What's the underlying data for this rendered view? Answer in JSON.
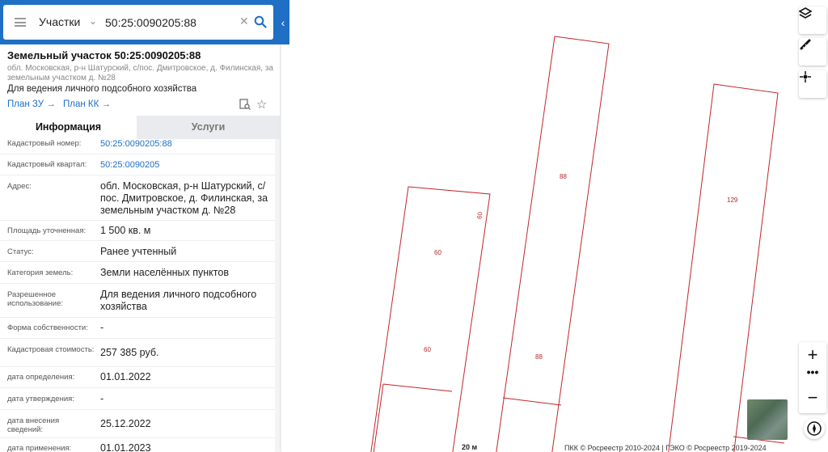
{
  "search": {
    "mode": "Участки",
    "query": "50:25:0090205:88"
  },
  "parcel": {
    "title": "Земельный участок 50:25:0090205:88",
    "address_short": "обл. Московская, р-н Шатурский, с/пос. Дмитровское, д. Филинская, за земельным участком д. №28",
    "usage": "Для ведения личного подсобного хозяйства",
    "link_plan_zu": "План ЗУ",
    "link_plan_kk": "План КК"
  },
  "tabs": {
    "info": "Информация",
    "services": "Услуги"
  },
  "info_rows": [
    {
      "label": "Кадастровый номер:",
      "value": "50:25:0090205:88",
      "link": true
    },
    {
      "label": "Кадастровый квартал:",
      "value": "50:25:0090205",
      "link": true
    },
    {
      "label": "Адрес:",
      "value": "обл. Московская, р-н Шатурский, с/пос. Дмитровское, д. Филинская, за земельным участком д. №28",
      "link": false
    },
    {
      "label": "Площадь уточненная:",
      "value": "1 500 кв. м",
      "link": false
    },
    {
      "label": "Статус:",
      "value": "Ранее учтенный",
      "link": false
    },
    {
      "label": "Категория земель:",
      "value": "Земли населённых пунктов",
      "link": false
    },
    {
      "label": "Разрешенное использование:",
      "value": "Для ведения личного подсобного хозяйства",
      "link": false
    },
    {
      "label": "Форма собственности:",
      "value": "-",
      "link": false
    },
    {
      "label": "Кадастровая стоимость:",
      "value": "257 385 руб.",
      "link": false
    },
    {
      "label": "дата определения:",
      "value": "01.01.2022",
      "link": false
    },
    {
      "label": "дата утверждения:",
      "value": "-",
      "link": false
    },
    {
      "label": "дата внесения сведений:",
      "value": "25.12.2022",
      "link": false
    },
    {
      "label": "дата применения:",
      "value": "01.01.2023",
      "link": false
    }
  ],
  "map": {
    "plot_labels": [
      "60",
      "60",
      "60",
      "88",
      "88",
      "129"
    ],
    "scale": "20 м",
    "copyright": "ПКК © Росреестр 2010-2024 | ГЭКО © Росреестр 2019-2024",
    "zoom_in": "+",
    "zoom_more": "•••",
    "zoom_out": "−"
  },
  "colors": {
    "accent": "#1f6fc5",
    "plot_border": "#c0262b"
  },
  "icons": {
    "layers": "layers-icon",
    "ruler": "ruler-icon",
    "locate": "crosshair-icon",
    "compass": "compass-icon"
  }
}
